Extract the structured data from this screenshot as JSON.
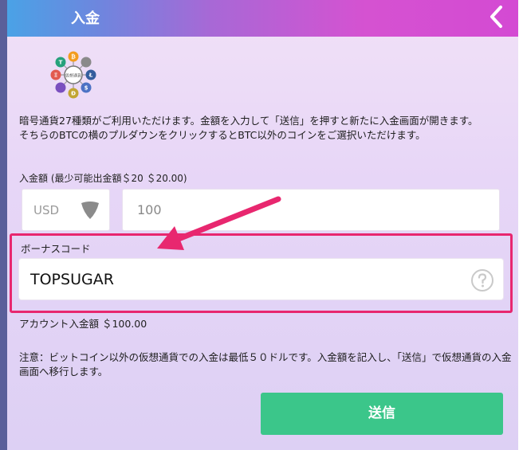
{
  "header": {
    "title": "入金",
    "back_icon": "chevron-left-icon"
  },
  "logo": {
    "icon": "crypto-coins-logo",
    "center_text": "仮想通貨",
    "coin_letters": [
      "₿",
      "Ł",
      "Ð",
      "Ξ",
      "T",
      "$"
    ]
  },
  "notice": {
    "line1": "暗号通貨27種類がご利用いただけます。金額を入力して「送信」を押すと新たに入金画面が開きます。",
    "line2": "そちらのBTCの横のプルダウンをクリックするとBTC以外のコインをご選択いただけます。"
  },
  "amount": {
    "label": "入金額 (最少可能出金額＄20 ＄20.00)",
    "currency": "USD",
    "value": "100"
  },
  "bonus": {
    "label": "ボーナスコード",
    "value": "TOPSUGAR",
    "help_icon": "question-circle-icon"
  },
  "balance": {
    "text": "アカウント入金額 ＄100.00"
  },
  "warning": {
    "text": "注意：ビットコイン以外の仮想通貨での入金は最低５０ドルです。入金額を記入し、「送信」で仮想通貨の入金画面へ移行します。"
  },
  "submit": {
    "label": "送信"
  },
  "colors": {
    "highlight_border": "#e8276f",
    "submit_bg": "#3bc68a",
    "arrow": "#e8276f"
  }
}
